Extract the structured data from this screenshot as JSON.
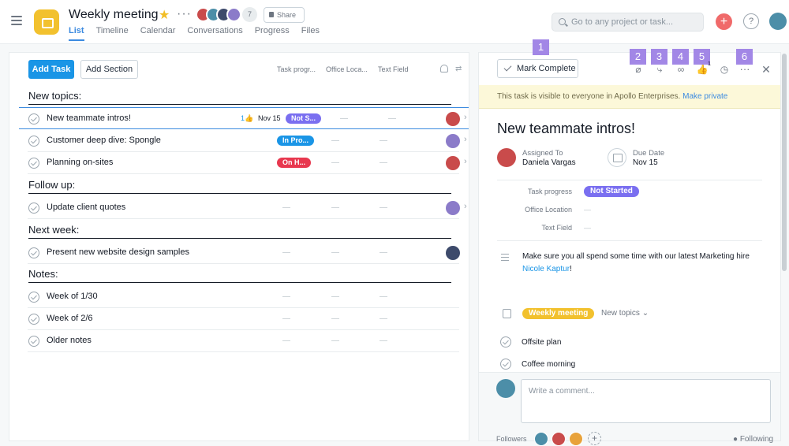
{
  "header": {
    "project_title": "Weekly meeting",
    "member_count": "7",
    "share_label": "Share",
    "tabs": [
      {
        "label": "List",
        "active": true
      },
      {
        "label": "Timeline"
      },
      {
        "label": "Calendar"
      },
      {
        "label": "Conversations"
      },
      {
        "label": "Progress"
      },
      {
        "label": "Files"
      }
    ],
    "search_placeholder": "Go to any project or task...",
    "help_label": "?"
  },
  "list": {
    "add_task_label": "Add Task",
    "add_section_label": "Add Section",
    "columns": [
      "Task progr...",
      "Office Loca...",
      "Text Field"
    ],
    "sections": [
      {
        "title": "New topics:",
        "tasks": [
          {
            "name": "New teammate intros!",
            "likes": "1",
            "due": "Nov 15",
            "status": "Not S...",
            "status_color": "#7a6ff0",
            "office": "—",
            "text": "—",
            "avatar": "#c94b4b",
            "selected": true
          },
          {
            "name": "Customer deep dive: Spongle",
            "status": "In Pro...",
            "status_color": "#1a95e6",
            "office": "—",
            "text": "—",
            "avatar": "#8b7bc9"
          },
          {
            "name": "Planning on-sites",
            "status": "On H...",
            "status_color": "#e8384f",
            "office": "—",
            "text": "—",
            "avatar": "#c94b4b"
          }
        ]
      },
      {
        "title": "Follow up:",
        "tasks": [
          {
            "name": "Update client quotes",
            "status_dash": "—",
            "office": "—",
            "text": "—",
            "avatar": "#8b7bc9"
          }
        ]
      },
      {
        "title": "Next week:",
        "tasks": [
          {
            "name": "Present new website design samples",
            "status_dash": "—",
            "office": "—",
            "text": "—",
            "avatar": "#3d4a6b"
          }
        ]
      },
      {
        "title": "Notes:",
        "tasks": [
          {
            "name": "Week of 1/30",
            "status_dash": "—",
            "office": "—",
            "text": "—"
          },
          {
            "name": "Week of 2/6",
            "status_dash": "—",
            "office": "—",
            "text": "—"
          },
          {
            "name": "Older notes",
            "status_dash": "—",
            "office": "—",
            "text": "—"
          }
        ]
      }
    ]
  },
  "detail": {
    "mark_complete_label": "Mark Complete",
    "toolbar_badges": [
      "1",
      "2",
      "3",
      "4",
      "5",
      "6"
    ],
    "like_count": "1",
    "visibility_text": "This task is visible to everyone in Apollo Enterprises.",
    "make_private_label": "Make private",
    "title": "New teammate intros!",
    "assigned_label": "Assigned To",
    "assignee": "Daniela Vargas",
    "due_label": "Due Date",
    "due_date": "Nov 15",
    "fields": {
      "progress_label": "Task progress",
      "progress_value": "Not Started",
      "office_label": "Office Location",
      "office_value": "—",
      "text_label": "Text Field",
      "text_value": "—"
    },
    "description_pre": "Make sure you all spend some time with our latest Marketing hire ",
    "description_mention": "Nicole Kaptur",
    "description_post": "!",
    "project_pill": "Weekly meeting",
    "section_dropdown": "New topics",
    "subtasks": [
      "Offsite plan",
      "Coffee morning"
    ],
    "comment_placeholder": "Write a comment...",
    "followers_label": "Followers",
    "following_label": "Following"
  },
  "colors": {
    "accent": "#1a95e6",
    "badge": "#a287e6",
    "project": "#f2c12e"
  }
}
